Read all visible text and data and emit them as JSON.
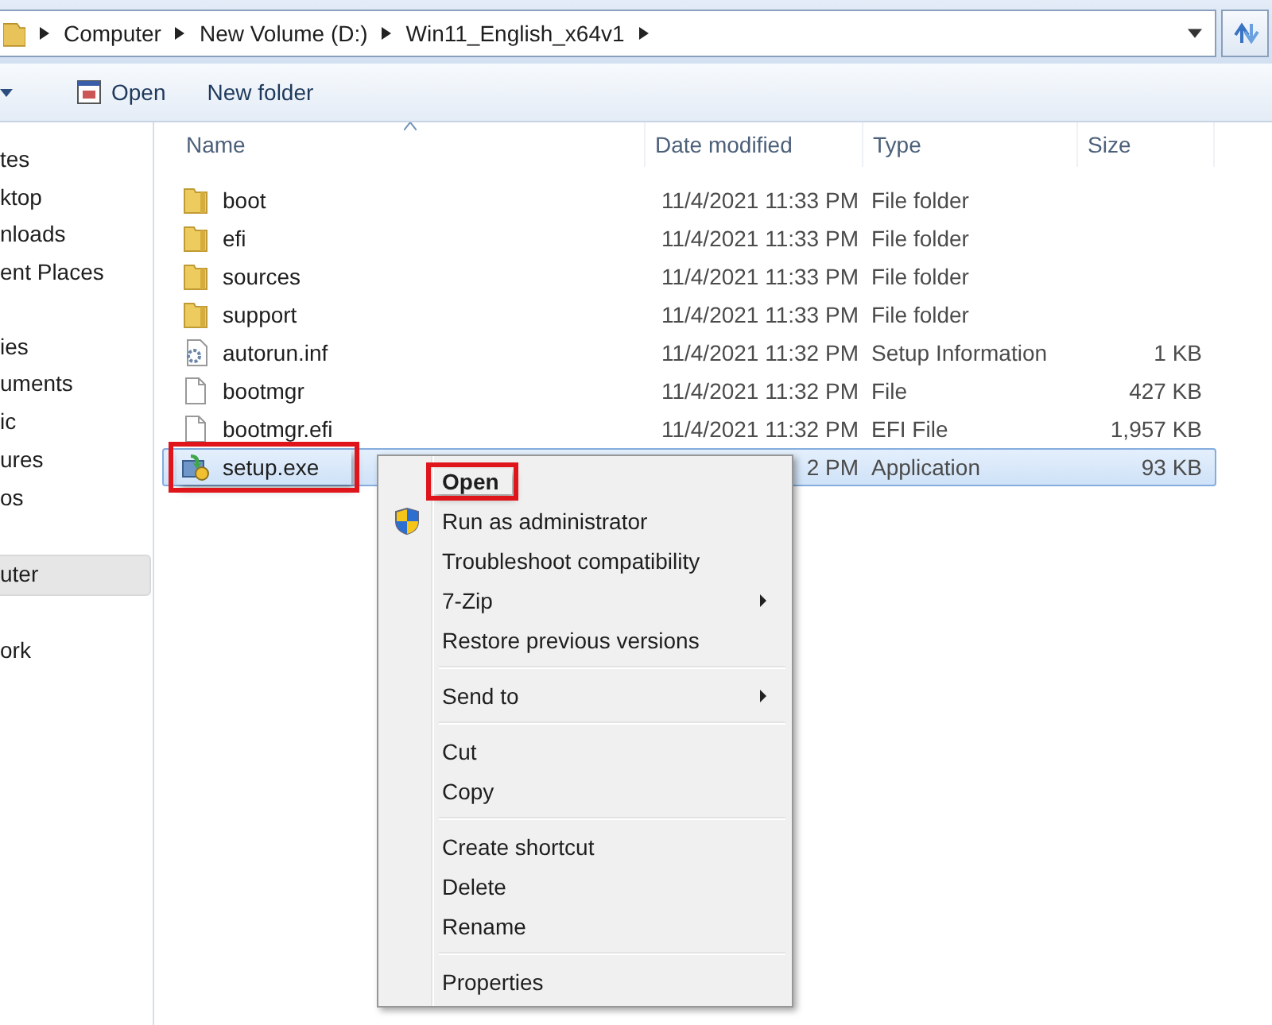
{
  "address_bar": {
    "crumbs": [
      "Computer",
      "New Volume (D:)",
      "Win11_English_x64v1"
    ]
  },
  "toolbar": {
    "buttons": [
      {
        "label": "Open",
        "kind": "open"
      },
      {
        "label": "New folder",
        "kind": "plain"
      }
    ]
  },
  "sidebar": {
    "groups": [
      {
        "items": [
          {
            "label": "tes",
            "selected": false
          },
          {
            "label": "ktop",
            "selected": false
          },
          {
            "label": "nloads",
            "selected": false
          },
          {
            "label": "ent Places",
            "selected": false
          }
        ]
      },
      {
        "items": [
          {
            "label": "ies",
            "selected": false
          },
          {
            "label": "uments",
            "selected": false
          },
          {
            "label": "ic",
            "selected": false
          },
          {
            "label": "ures",
            "selected": false
          },
          {
            "label": "os",
            "selected": false
          }
        ]
      },
      {
        "items": [
          {
            "label": "uter",
            "selected": true
          }
        ]
      },
      {
        "items": [
          {
            "label": "ork",
            "selected": false
          }
        ]
      }
    ]
  },
  "table": {
    "columns": [
      "Name",
      "Date modified",
      "Type",
      "Size"
    ],
    "rows": [
      {
        "name": "boot",
        "date": "11/4/2021 11:33 PM",
        "type": "File folder",
        "size": "",
        "kind": "folder",
        "selected": false,
        "highlighted": false
      },
      {
        "name": "efi",
        "date": "11/4/2021 11:33 PM",
        "type": "File folder",
        "size": "",
        "kind": "folder",
        "selected": false,
        "highlighted": false
      },
      {
        "name": "sources",
        "date": "11/4/2021 11:33 PM",
        "type": "File folder",
        "size": "",
        "kind": "folder",
        "selected": false,
        "highlighted": false
      },
      {
        "name": "support",
        "date": "11/4/2021 11:33 PM",
        "type": "File folder",
        "size": "",
        "kind": "folder",
        "selected": false,
        "highlighted": false
      },
      {
        "name": "autorun.inf",
        "date": "11/4/2021 11:32 PM",
        "type": "Setup Information",
        "size": "1 KB",
        "kind": "settings",
        "selected": false,
        "highlighted": false
      },
      {
        "name": "bootmgr",
        "date": "11/4/2021 11:32 PM",
        "type": "File",
        "size": "427 KB",
        "kind": "file",
        "selected": false,
        "highlighted": false
      },
      {
        "name": "bootmgr.efi",
        "date": "11/4/2021 11:32 PM",
        "type": "EFI File",
        "size": "1,957 KB",
        "kind": "file",
        "selected": false,
        "highlighted": false
      },
      {
        "name": "setup.exe",
        "date": "2 PM",
        "type": "Application",
        "size": "93 KB",
        "kind": "app",
        "selected": true,
        "highlighted": true
      }
    ]
  },
  "context_menu": {
    "items": [
      {
        "kind": "item",
        "label": "Open",
        "bold": true,
        "submenu": false,
        "highlighted": true
      },
      {
        "kind": "shield_item",
        "label": "Run as administrator",
        "bold": false,
        "submenu": false,
        "highlighted": false
      },
      {
        "kind": "item",
        "label": "Troubleshoot compatibility",
        "bold": false,
        "submenu": false,
        "highlighted": false
      },
      {
        "kind": "item",
        "label": "7-Zip",
        "bold": false,
        "submenu": true,
        "highlighted": false
      },
      {
        "kind": "item",
        "label": "Restore previous versions",
        "bold": false,
        "submenu": false,
        "highlighted": false
      },
      {
        "kind": "separator"
      },
      {
        "kind": "item",
        "label": "Send to",
        "bold": false,
        "submenu": true,
        "highlighted": false
      },
      {
        "kind": "separator"
      },
      {
        "kind": "item",
        "label": "Cut",
        "bold": false,
        "submenu": false,
        "highlighted": false
      },
      {
        "kind": "item",
        "label": "Copy",
        "bold": false,
        "submenu": false,
        "highlighted": false
      },
      {
        "kind": "separator"
      },
      {
        "kind": "item",
        "label": "Create shortcut",
        "bold": false,
        "submenu": false,
        "highlighted": false
      },
      {
        "kind": "item",
        "label": "Delete",
        "bold": false,
        "submenu": false,
        "highlighted": false
      },
      {
        "kind": "item",
        "label": "Rename",
        "bold": false,
        "submenu": false,
        "highlighted": false
      },
      {
        "kind": "separator"
      },
      {
        "kind": "item",
        "label": "Properties",
        "bold": false,
        "submenu": false,
        "highlighted": false
      }
    ]
  }
}
